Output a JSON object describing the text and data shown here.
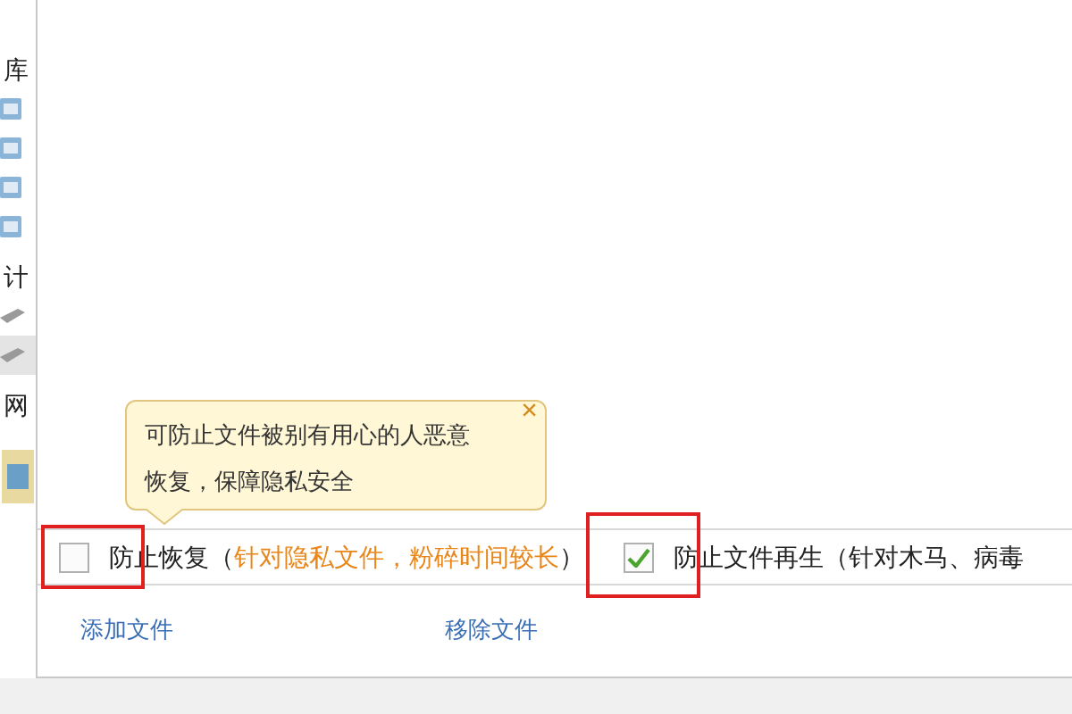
{
  "sidebar": {
    "items": [
      {
        "kind": "heading",
        "label": "库",
        "selected": false
      },
      {
        "kind": "icon",
        "selected": false
      },
      {
        "kind": "icon",
        "selected": false
      },
      {
        "kind": "icon",
        "selected": false
      },
      {
        "kind": "icon",
        "selected": false
      },
      {
        "kind": "heading",
        "label": "计",
        "selected": false
      },
      {
        "kind": "drive",
        "selected": false
      },
      {
        "kind": "drive",
        "selected": true
      },
      {
        "kind": "heading",
        "label": "网",
        "selected": false
      }
    ]
  },
  "tooltip": {
    "lines": [
      "可防止文件被别有用心的人恶意",
      "恢复，保障隐私安全"
    ],
    "close": "×"
  },
  "options": [
    {
      "checked": false,
      "highlighted": true,
      "prefix": "防止恢复（",
      "note": "针对隐私文件，粉碎时间较长",
      "suffix": "）"
    },
    {
      "checked": true,
      "highlighted": true,
      "prefix": "防止文件再生（针对木马、病毒"
    }
  ],
  "links": [
    "添加文件",
    "移除文件"
  ]
}
